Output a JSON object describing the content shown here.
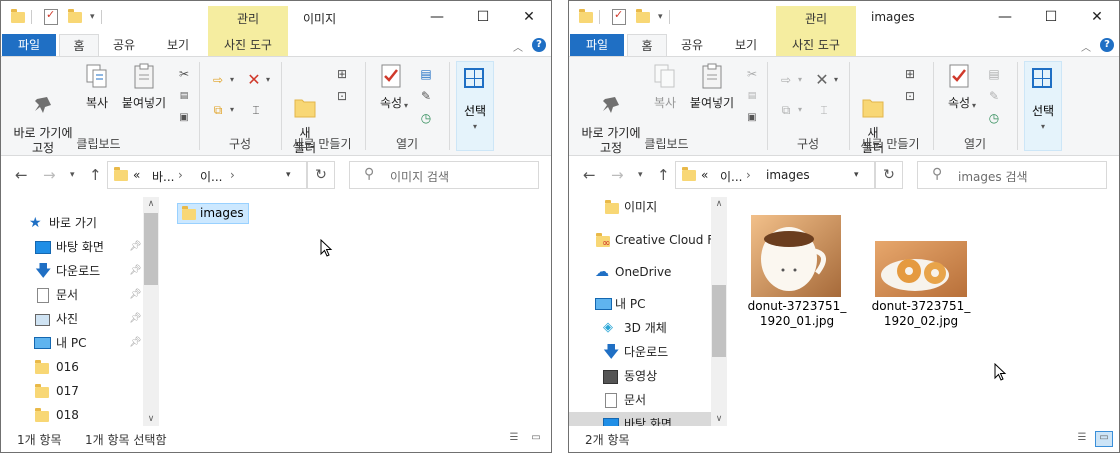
{
  "left_window": {
    "title": "이미지",
    "context_group": "관리",
    "tabs": {
      "file": "파일",
      "home": "홈",
      "share": "공유",
      "view": "보기",
      "picture_tools": "사진 도구"
    },
    "ribbon": {
      "pin_quick_access": "바로 가기에\n고정",
      "copy": "복사",
      "paste": "붙여넣기",
      "clipboard_group": "클립보드",
      "organize_group": "구성",
      "new_folder": "새\n폴더",
      "new_group": "새로 만들기",
      "properties": "속성",
      "open_group": "열기",
      "select": "선택"
    },
    "address": {
      "part1": "«",
      "part2": "바...",
      "part3": "이...",
      "chevron": "›"
    },
    "search_placeholder": "이미지 검색",
    "nav": [
      {
        "label": "바로 가기",
        "icon": "star-icon"
      },
      {
        "label": "바탕 화면",
        "icon": "desktop-icon",
        "pinned": true
      },
      {
        "label": "다운로드",
        "icon": "download-icon",
        "pinned": true
      },
      {
        "label": "문서",
        "icon": "document-icon",
        "pinned": true
      },
      {
        "label": "사진",
        "icon": "pictures-icon",
        "pinned": true
      },
      {
        "label": "내 PC",
        "icon": "pc-icon",
        "pinned": true
      },
      {
        "label": "016",
        "icon": "folder-icon"
      },
      {
        "label": "017",
        "icon": "folder-icon"
      },
      {
        "label": "018",
        "icon": "folder-icon"
      }
    ],
    "files": [
      {
        "name": "images",
        "selected": true
      }
    ],
    "status": {
      "count": "1개 항목",
      "selected": "1개 항목 선택함"
    }
  },
  "right_window": {
    "title": "images",
    "context_group": "관리",
    "tabs": {
      "file": "파일",
      "home": "홈",
      "share": "공유",
      "view": "보기",
      "picture_tools": "사진 도구"
    },
    "ribbon": {
      "pin_quick_access": "바로 가기에\n고정",
      "copy": "복사",
      "paste": "붙여넣기",
      "clipboard_group": "클립보드",
      "organize_group": "구성",
      "new_folder": "새\n폴더",
      "new_group": "새로 만들기",
      "properties": "속성",
      "open_group": "열기",
      "select": "선택"
    },
    "address": {
      "part1": "«",
      "part2": "이...",
      "part3": "images",
      "chevron": "›"
    },
    "search_placeholder": "images 검색",
    "nav": [
      {
        "label": "이미지",
        "icon": "folder-icon"
      },
      {
        "label": "Creative Cloud Fil",
        "icon": "creative-cloud-icon"
      },
      {
        "label": "OneDrive",
        "icon": "onedrive-icon"
      },
      {
        "label": "내 PC",
        "icon": "pc-icon"
      },
      {
        "label": "3D 개체",
        "icon": "3d-objects-icon"
      },
      {
        "label": "다운로드",
        "icon": "download-icon"
      },
      {
        "label": "동영상",
        "icon": "video-icon"
      },
      {
        "label": "문서",
        "icon": "document-icon"
      },
      {
        "label": "바탕 화면",
        "icon": "desktop-icon",
        "selected": true
      }
    ],
    "files": [
      {
        "name": "donut-3723751_\n1920_01.jpg"
      },
      {
        "name": "donut-3723751_\n1920_02.jpg"
      }
    ],
    "status": {
      "count": "2개 항목"
    }
  },
  "window_controls": {
    "minimize": "—",
    "maximize": "☐",
    "close": "✕"
  }
}
